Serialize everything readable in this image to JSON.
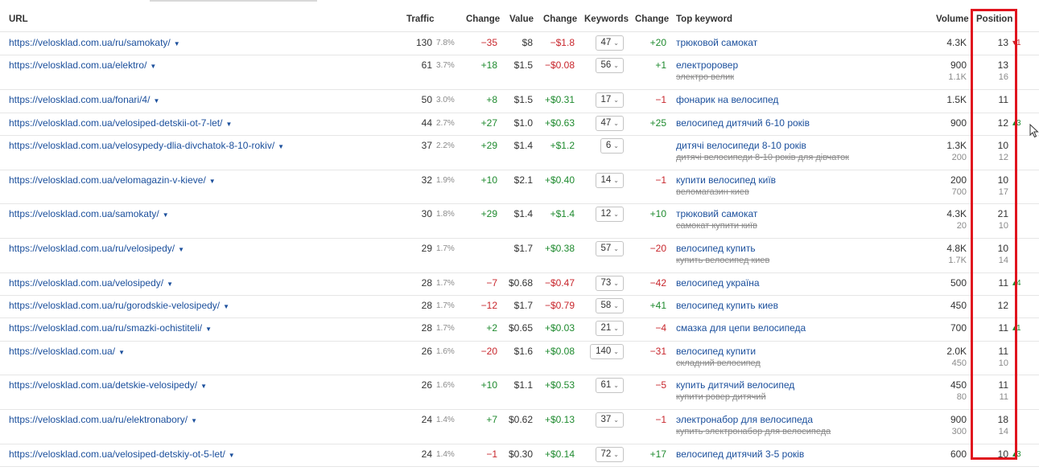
{
  "header": {
    "url": "URL",
    "traffic": "Traffic",
    "change1": "Change",
    "value": "Value",
    "change2": "Change",
    "keywords": "Keywords",
    "change3": "Change",
    "top_keyword": "Top keyword",
    "volume": "Volume",
    "position": "Position"
  },
  "rows": [
    {
      "url": "https://velosklad.com.ua/ru/samokaty/",
      "traffic": "130",
      "pct": "7.8%",
      "chg1": "−35",
      "chg1_dir": "down",
      "value": "$8",
      "chg2": "−$1.8",
      "chg2_dir": "down",
      "kw": "47",
      "chg3": "+20",
      "chg3_dir": "up",
      "kw1": "трюковой самокат",
      "kw2": "",
      "vol1": "4.3K",
      "vol2": "",
      "pos1": "13",
      "pos2": "",
      "pc": "▾1",
      "pc_dir": "down"
    },
    {
      "url": "https://velosklad.com.ua/elektro/",
      "traffic": "61",
      "pct": "3.7%",
      "chg1": "+18",
      "chg1_dir": "up",
      "value": "$1.5",
      "chg2": "−$0.08",
      "chg2_dir": "down",
      "kw": "56",
      "chg3": "+1",
      "chg3_dir": "up",
      "kw1": "електроровер",
      "kw2": "электро велик",
      "vol1": "900",
      "vol2": "1.1K",
      "pos1": "13",
      "pos2": "16",
      "pc": "",
      "pc_dir": ""
    },
    {
      "url": "https://velosklad.com.ua/fonari/4/",
      "traffic": "50",
      "pct": "3.0%",
      "chg1": "+8",
      "chg1_dir": "up",
      "value": "$1.5",
      "chg2": "+$0.31",
      "chg2_dir": "up",
      "kw": "17",
      "chg3": "−1",
      "chg3_dir": "down",
      "kw1": "фонарик на велосипед",
      "kw2": "",
      "vol1": "1.5K",
      "vol2": "",
      "pos1": "11",
      "pos2": "",
      "pc": "",
      "pc_dir": ""
    },
    {
      "url": "https://velosklad.com.ua/velosiped-detskii-ot-7-let/",
      "traffic": "44",
      "pct": "2.7%",
      "chg1": "+27",
      "chg1_dir": "up",
      "value": "$1.0",
      "chg2": "+$0.63",
      "chg2_dir": "up",
      "kw": "47",
      "chg3": "+25",
      "chg3_dir": "up",
      "kw1": "велосипед дитячий 6-10 років",
      "kw2": "",
      "vol1": "900",
      "vol2": "",
      "pos1": "12",
      "pos2": "",
      "pc": "▴3",
      "pc_dir": "up"
    },
    {
      "url": "https://velosklad.com.ua/velosypedy-dlia-divchatok-8-10-rokiv/",
      "traffic": "37",
      "pct": "2.2%",
      "chg1": "+29",
      "chg1_dir": "up",
      "value": "$1.4",
      "chg2": "+$1.2",
      "chg2_dir": "up",
      "kw": "6",
      "chg3": "",
      "chg3_dir": "",
      "kw1": "дитячі велосипеди 8-10 років",
      "kw2": "дитячі велосипеди 8-10 років для дівчаток",
      "vol1": "1.3K",
      "vol2": "200",
      "pos1": "10",
      "pos2": "12",
      "pc": "",
      "pc_dir": ""
    },
    {
      "url": "https://velosklad.com.ua/velomagazin-v-kieve/",
      "traffic": "32",
      "pct": "1.9%",
      "chg1": "+10",
      "chg1_dir": "up",
      "value": "$2.1",
      "chg2": "+$0.40",
      "chg2_dir": "up",
      "kw": "14",
      "chg3": "−1",
      "chg3_dir": "down",
      "kw1": "купити велосипед київ",
      "kw2": "веломагазин киев",
      "vol1": "200",
      "vol2": "700",
      "pos1": "10",
      "pos2": "17",
      "pc": "",
      "pc_dir": ""
    },
    {
      "url": "https://velosklad.com.ua/samokaty/",
      "traffic": "30",
      "pct": "1.8%",
      "chg1": "+29",
      "chg1_dir": "up",
      "value": "$1.4",
      "chg2": "+$1.4",
      "chg2_dir": "up",
      "kw": "12",
      "chg3": "+10",
      "chg3_dir": "up",
      "kw1": "трюковий самокат",
      "kw2": "самокат купити київ",
      "vol1": "4.3K",
      "vol2": "20",
      "pos1": "21",
      "pos2": "10",
      "pc": "",
      "pc_dir": ""
    },
    {
      "url": "https://velosklad.com.ua/ru/velosipedy/",
      "traffic": "29",
      "pct": "1.7%",
      "chg1": "",
      "chg1_dir": "",
      "value": "$1.7",
      "chg2": "+$0.38",
      "chg2_dir": "up",
      "kw": "57",
      "chg3": "−20",
      "chg3_dir": "down",
      "kw1": "велосипед купить",
      "kw2": "купить велосипед киев",
      "vol1": "4.8K",
      "vol2": "1.7K",
      "pos1": "10",
      "pos2": "14",
      "pc": "",
      "pc_dir": ""
    },
    {
      "url": "https://velosklad.com.ua/velosipedy/",
      "traffic": "28",
      "pct": "1.7%",
      "chg1": "−7",
      "chg1_dir": "down",
      "value": "$0.68",
      "chg2": "−$0.47",
      "chg2_dir": "down",
      "kw": "73",
      "chg3": "−42",
      "chg3_dir": "down",
      "kw1": "велосипед україна",
      "kw2": "",
      "vol1": "500",
      "vol2": "",
      "pos1": "11",
      "pos2": "",
      "pc": "▴4",
      "pc_dir": "up"
    },
    {
      "url": "https://velosklad.com.ua/ru/gorodskie-velosipedy/",
      "traffic": "28",
      "pct": "1.7%",
      "chg1": "−12",
      "chg1_dir": "down",
      "value": "$1.7",
      "chg2": "−$0.79",
      "chg2_dir": "down",
      "kw": "58",
      "chg3": "+41",
      "chg3_dir": "up",
      "kw1": "велосипед купить киев",
      "kw2": "",
      "vol1": "450",
      "vol2": "",
      "pos1": "12",
      "pos2": "",
      "pc": "",
      "pc_dir": ""
    },
    {
      "url": "https://velosklad.com.ua/ru/smazki-ochistiteli/",
      "traffic": "28",
      "pct": "1.7%",
      "chg1": "+2",
      "chg1_dir": "up",
      "value": "$0.65",
      "chg2": "+$0.03",
      "chg2_dir": "up",
      "kw": "21",
      "chg3": "−4",
      "chg3_dir": "down",
      "kw1": "смазка для цепи велосипеда",
      "kw2": "",
      "vol1": "700",
      "vol2": "",
      "pos1": "11",
      "pos2": "",
      "pc": "▴1",
      "pc_dir": "up"
    },
    {
      "url": "https://velosklad.com.ua/",
      "traffic": "26",
      "pct": "1.6%",
      "chg1": "−20",
      "chg1_dir": "down",
      "value": "$1.6",
      "chg2": "+$0.08",
      "chg2_dir": "up",
      "kw": "140",
      "chg3": "−31",
      "chg3_dir": "down",
      "kw1": "велосипед купити",
      "kw2": "складний велосипед",
      "vol1": "2.0K",
      "vol2": "450",
      "pos1": "11",
      "pos2": "10",
      "pc": "",
      "pc_dir": ""
    },
    {
      "url": "https://velosklad.com.ua/detskie-velosipedy/",
      "traffic": "26",
      "pct": "1.6%",
      "chg1": "+10",
      "chg1_dir": "up",
      "value": "$1.1",
      "chg2": "+$0.53",
      "chg2_dir": "up",
      "kw": "61",
      "chg3": "−5",
      "chg3_dir": "down",
      "kw1": "купить дитячий велосипед",
      "kw2": "купити ровер дитячий",
      "vol1": "450",
      "vol2": "80",
      "pos1": "11",
      "pos2": "11",
      "pc": "",
      "pc_dir": ""
    },
    {
      "url": "https://velosklad.com.ua/ru/elektronabory/",
      "traffic": "24",
      "pct": "1.4%",
      "chg1": "+7",
      "chg1_dir": "up",
      "value": "$0.62",
      "chg2": "+$0.13",
      "chg2_dir": "up",
      "kw": "37",
      "chg3": "−1",
      "chg3_dir": "down",
      "kw1": "электронабор для велосипеда",
      "kw2": "купить электронабор для велосипеда",
      "vol1": "900",
      "vol2": "300",
      "pos1": "18",
      "pos2": "14",
      "pc": "",
      "pc_dir": ""
    },
    {
      "url": "https://velosklad.com.ua/velosiped-detskiy-ot-5-let/",
      "traffic": "24",
      "pct": "1.4%",
      "chg1": "−1",
      "chg1_dir": "down",
      "value": "$0.30",
      "chg2": "+$0.14",
      "chg2_dir": "up",
      "kw": "72",
      "chg3": "+17",
      "chg3_dir": "up",
      "kw1": "велосипед дитячий 3-5 років",
      "kw2": "",
      "vol1": "600",
      "vol2": "",
      "pos1": "10",
      "pos2": "",
      "pc": "▴3",
      "pc_dir": "up"
    }
  ],
  "colors": {
    "link": "#1b4f9c",
    "positive": "#1e8a2e",
    "negative": "#c8262c",
    "highlight": "#e0141e"
  }
}
